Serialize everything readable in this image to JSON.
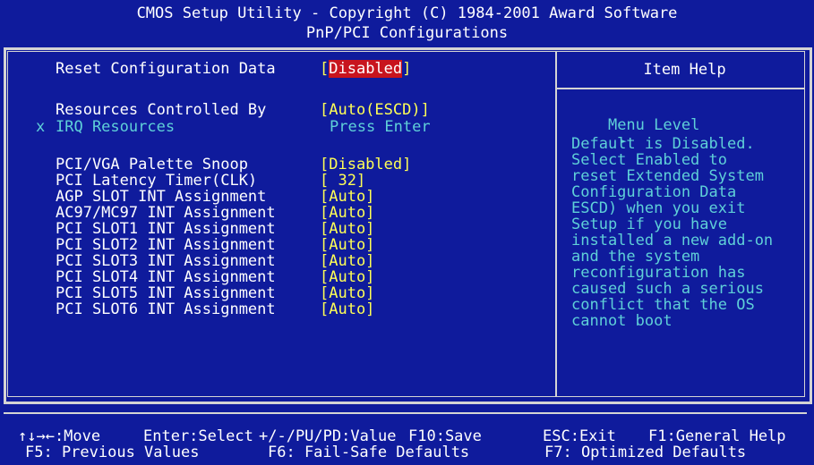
{
  "header": {
    "title": "CMOS Setup Utility - Copyright (C) 1984-2001 Award Software",
    "subtitle": "PnP/PCI Configurations"
  },
  "settings": [
    {
      "label": "Reset Configuration Data",
      "value": "Disabled"
    },
    {
      "label": "Resources Controlled By",
      "value": "[Auto(ESCD)]"
    },
    {
      "label": "IRQ Resources",
      "value": "Press Enter",
      "marker": "x"
    },
    {
      "label": "PCI/VGA Palette Snoop",
      "value": "[Disabled]"
    },
    {
      "label": "PCI Latency Timer(CLK)",
      "value": "[ 32]"
    },
    {
      "label": "AGP SLOT INT Assignment",
      "value": "[Auto]"
    },
    {
      "label": "AC97/MC97 INT Assignment",
      "value": "[Auto]"
    },
    {
      "label": "PCI SLOT1 INT Assignment",
      "value": "[Auto]"
    },
    {
      "label": "PCI SLOT2 INT Assignment",
      "value": "[Auto]"
    },
    {
      "label": "PCI SLOT3 INT Assignment",
      "value": "[Auto]"
    },
    {
      "label": "PCI SLOT4 INT Assignment",
      "value": "[Auto]"
    },
    {
      "label": "PCI SLOT5 INT Assignment",
      "value": "[Auto]"
    },
    {
      "label": "PCI SLOT6 INT Assignment",
      "value": "[Auto]"
    }
  ],
  "help": {
    "title": "Item Help",
    "menu_level": "Menu Level",
    "menu_arrow": "►",
    "lines": [
      "Default is Disabled.",
      "Select Enabled to",
      "reset Extended System",
      "Configuration Data",
      "ESCD) when you exit",
      "Setup if you have",
      "installed a new add-on",
      "and the system",
      "reconfiguration has",
      "caused such a serious",
      "conflict that the OS",
      "cannot boot"
    ]
  },
  "footer": {
    "move": "↑↓→←:Move",
    "enter": "Enter:Select",
    "value": "+/-/PU/PD:Value",
    "save": "F10:Save",
    "exit": "ESC:Exit",
    "general_help": "F1:General Help",
    "previous": "F5: Previous Values",
    "failsafe": "F6: Fail-Safe Defaults",
    "optimized": "F7: Optimized Defaults"
  },
  "colors": {
    "background": "#0f1b9c",
    "label": "#ffffff",
    "value": "#ffff55",
    "disabled": "#5fd0d8",
    "highlight": "#c8141e",
    "frame": "#d4d4d4"
  }
}
